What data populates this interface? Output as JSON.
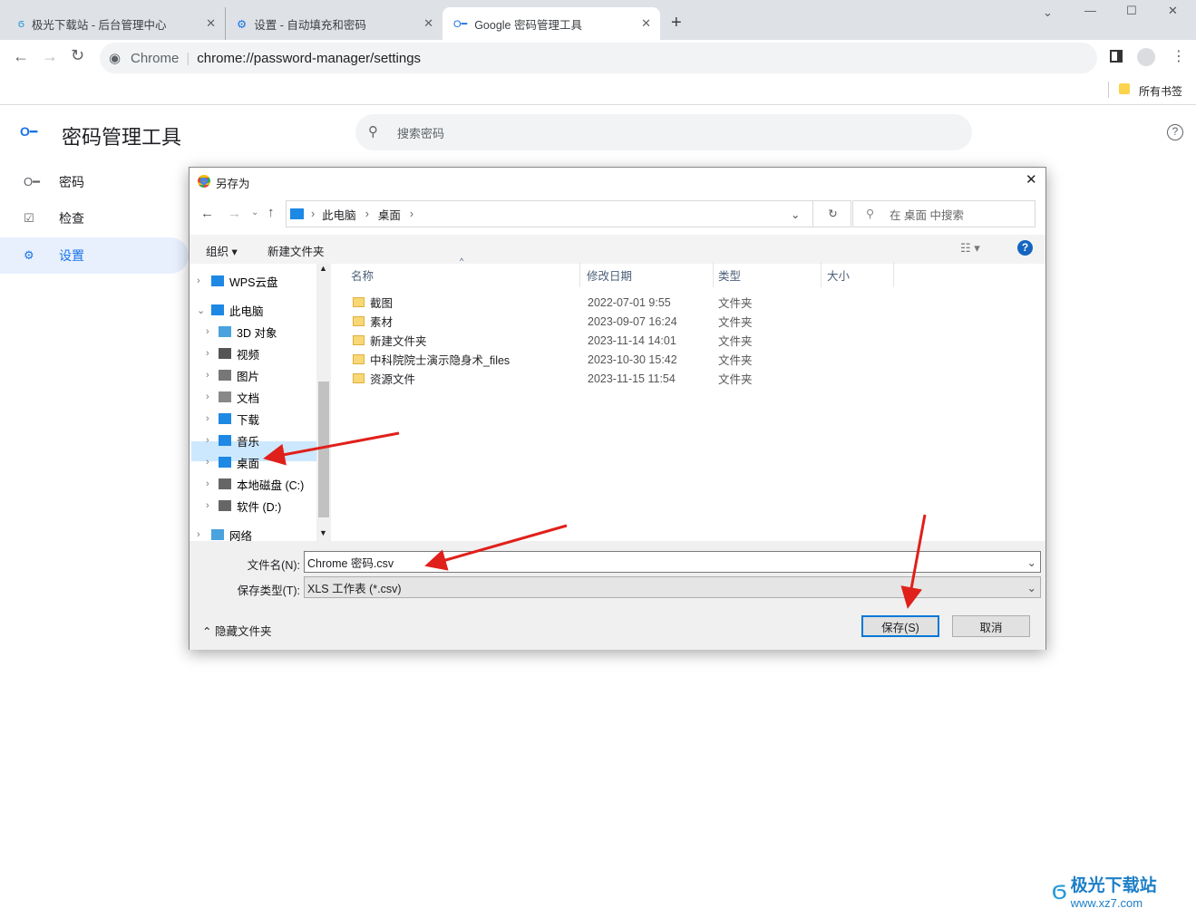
{
  "browser": {
    "tabs": [
      {
        "label": "极光下载站 - 后台管理中心",
        "icon": "jg-logo-icon"
      },
      {
        "label": "设置 - 自动填充和密码",
        "icon": "gear-icon"
      },
      {
        "label": "Google 密码管理工具",
        "icon": "key-icon",
        "active": true
      }
    ],
    "new_tab": "+",
    "omnibox_chip": "Chrome",
    "url": "chrome://password-manager/settings",
    "bookmarks_label": "所有书签"
  },
  "app": {
    "title": "密码管理工具",
    "search_placeholder": "搜索密码",
    "nav": [
      {
        "label": "密码",
        "icon": "key-icon"
      },
      {
        "label": "检查",
        "icon": "checkup-icon"
      },
      {
        "label": "设置",
        "icon": "gear-icon",
        "selected": true
      }
    ]
  },
  "dialog": {
    "title": "另存为",
    "breadcrumb": [
      "此电脑",
      "桌面"
    ],
    "search_placeholder": "在 桌面 中搜索",
    "organize": "组织",
    "new_folder": "新建文件夹",
    "tree": [
      {
        "label": "WPS云盘",
        "level": 0
      },
      {
        "label": "此电脑",
        "level": 0,
        "expanded": true
      },
      {
        "label": "3D 对象",
        "level": 1
      },
      {
        "label": "视频",
        "level": 1
      },
      {
        "label": "图片",
        "level": 1
      },
      {
        "label": "文档",
        "level": 1
      },
      {
        "label": "下载",
        "level": 1
      },
      {
        "label": "音乐",
        "level": 1
      },
      {
        "label": "桌面",
        "level": 1,
        "selected": true
      },
      {
        "label": "本地磁盘 (C:)",
        "level": 1
      },
      {
        "label": "软件 (D:)",
        "level": 1
      },
      {
        "label": "网络",
        "level": 0
      }
    ],
    "columns": [
      "名称",
      "修改日期",
      "类型",
      "大小"
    ],
    "files": [
      {
        "name": "截图",
        "date": "2022-07-01 9:55",
        "type": "文件夹"
      },
      {
        "name": "素材",
        "date": "2023-09-07 16:24",
        "type": "文件夹"
      },
      {
        "name": "新建文件夹",
        "date": "2023-11-14 14:01",
        "type": "文件夹"
      },
      {
        "name": "中科院院士演示隐身术_files",
        "date": "2023-10-30 15:42",
        "type": "文件夹"
      },
      {
        "name": "资源文件",
        "date": "2023-11-15 11:54",
        "type": "文件夹"
      }
    ],
    "filename_label": "文件名(N):",
    "filename_value": "Chrome 密码.csv",
    "filetype_label": "保存类型(T):",
    "filetype_value": "XLS 工作表 (*.csv)",
    "hide_folders": "隐藏文件夹",
    "save": "保存(S)",
    "cancel": "取消"
  },
  "watermark": {
    "name": "极光下载站",
    "url": "www.xz7.com"
  }
}
